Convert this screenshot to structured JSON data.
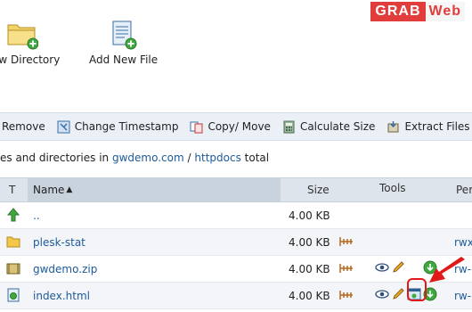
{
  "brand": {
    "part1": "GRAB",
    "part2": "Web"
  },
  "actions": {
    "new_directory": "New Directory",
    "add_new_file": "Add New File"
  },
  "toolbar": {
    "remove": "Remove",
    "change_timestamp": "Change Timestamp",
    "copy_move": "Copy/ Move",
    "calculate_size": "Calculate Size",
    "extract_files": "Extract Files"
  },
  "path": {
    "prefix": "es and directories in",
    "domain": "gwdemo.com",
    "separator": "/",
    "folder": "httpdocs",
    "suffix": "total"
  },
  "table": {
    "headers": {
      "type": "T",
      "name": "Name",
      "sort_indicator": "▲",
      "size": "Size",
      "tools": "Tools",
      "permissions": "Per"
    },
    "rows": [
      {
        "name": "..",
        "size": "4.00 KB",
        "icon": "up-arrow-icon",
        "perms": ""
      },
      {
        "name": "plesk-stat",
        "size": "4.00 KB",
        "icon": "folder-icon",
        "perms": "rwx"
      },
      {
        "name": "gwdemo.zip",
        "size": "4.00 KB",
        "icon": "archive-icon",
        "perms": "rw-"
      },
      {
        "name": "index.html",
        "size": "4.00 KB",
        "icon": "html-file-icon",
        "perms": "rw-"
      }
    ]
  },
  "colors": {
    "accent_red": "#e01818",
    "link": "#1d5b9a",
    "toolbar_bg": "#eaf0f6"
  }
}
